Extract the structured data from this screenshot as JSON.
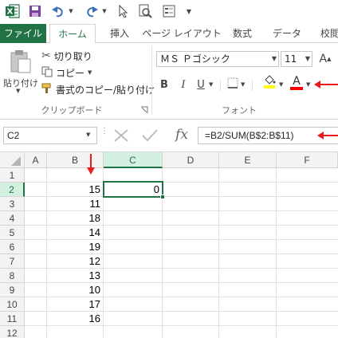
{
  "qat": {
    "icons": [
      "excel-logo-icon",
      "save-icon",
      "undo-icon",
      "redo-icon",
      "select-cursor-icon",
      "print-preview-icon",
      "form-icon",
      "customize-icon"
    ]
  },
  "tabs": [
    "ファイル",
    "ホーム",
    "挿入",
    "ページ レイアウト",
    "数式",
    "データ",
    "校閲"
  ],
  "clipboard": {
    "paste_label": "貼り付け",
    "cut_label": "切り取り",
    "copy_label": "コピー",
    "format_painter_label": "書式のコピー/貼り付け",
    "group_label": "クリップボード"
  },
  "font": {
    "font_name": "ＭＳ Ｐゴシック",
    "font_size": "11",
    "grow_label": "A",
    "shrink_label": "A",
    "bold_label": "B",
    "italic_label": "I",
    "underline_label": "U",
    "font_color_label": "A",
    "group_label": "フォント",
    "fill_color": "#ffff00",
    "font_color": "#ff0000"
  },
  "formula_bar": {
    "name_box": "C2",
    "fx_label": "fx",
    "formula": "=B2/SUM(B$2:B$11)"
  },
  "grid": {
    "columns": [
      "A",
      "B",
      "C",
      "D",
      "E",
      "F"
    ],
    "rows": [
      "1",
      "2",
      "3",
      "4",
      "5",
      "6",
      "7",
      "8",
      "9",
      "10",
      "11",
      "12"
    ],
    "selected_cell": "C2",
    "column_b": [
      "15",
      "11",
      "18",
      "14",
      "19",
      "12",
      "13",
      "10",
      "17",
      "16"
    ],
    "c2_value": "0"
  },
  "annotations": {
    "arrow_color": "#e81c1c"
  },
  "colors": {
    "excel_green": "#217346",
    "header_gray": "#f3f3f3",
    "selected_header": "#d3f0e0"
  }
}
